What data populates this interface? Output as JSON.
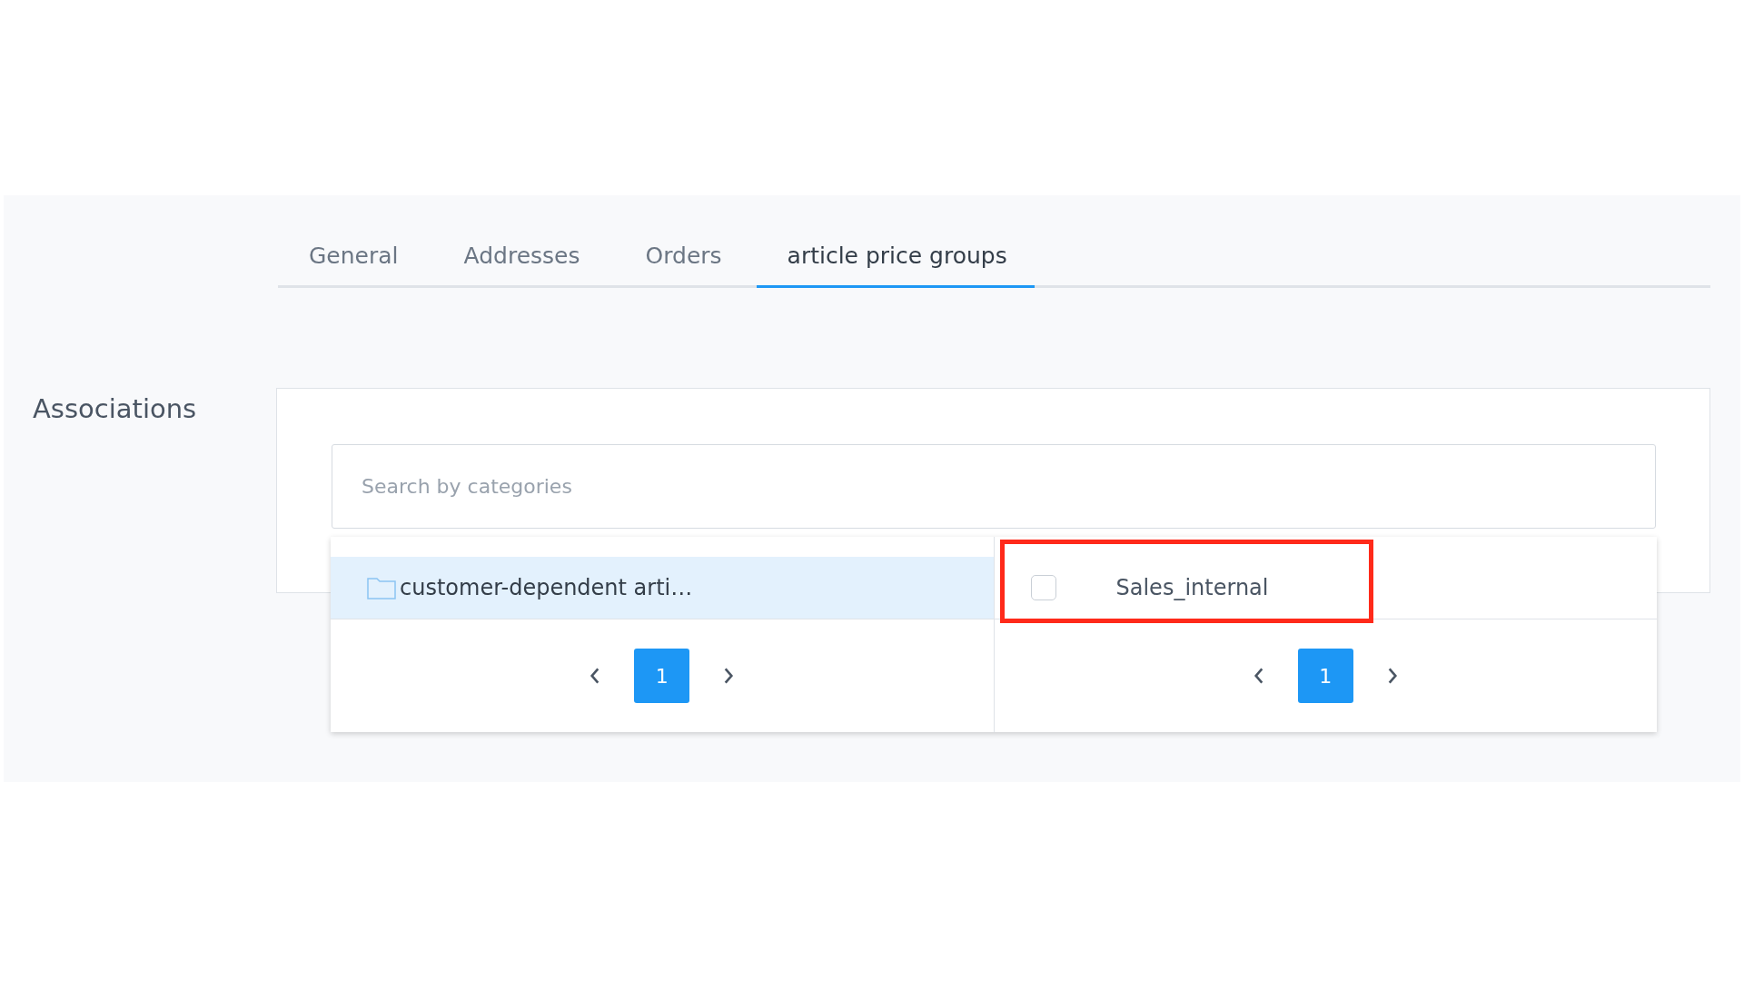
{
  "tabs": [
    {
      "label": "General",
      "selected": false
    },
    {
      "label": "Addresses",
      "selected": false
    },
    {
      "label": "Orders",
      "selected": false
    },
    {
      "label": "article price groups",
      "selected": true
    }
  ],
  "section": {
    "label": "Associations"
  },
  "search": {
    "placeholder": "Search by categories"
  },
  "panels": [
    {
      "items": [
        {
          "kind": "folder",
          "label": "customer-dependent arti…",
          "selected": true,
          "highlighted": false
        }
      ],
      "pages": [
        {
          "label": "1",
          "selected": true
        }
      ]
    },
    {
      "items": [
        {
          "kind": "checkbox",
          "label": "Sales_internal",
          "checked": false,
          "highlighted": true
        }
      ],
      "pages": [
        {
          "label": "1",
          "selected": true
        }
      ]
    }
  ]
}
